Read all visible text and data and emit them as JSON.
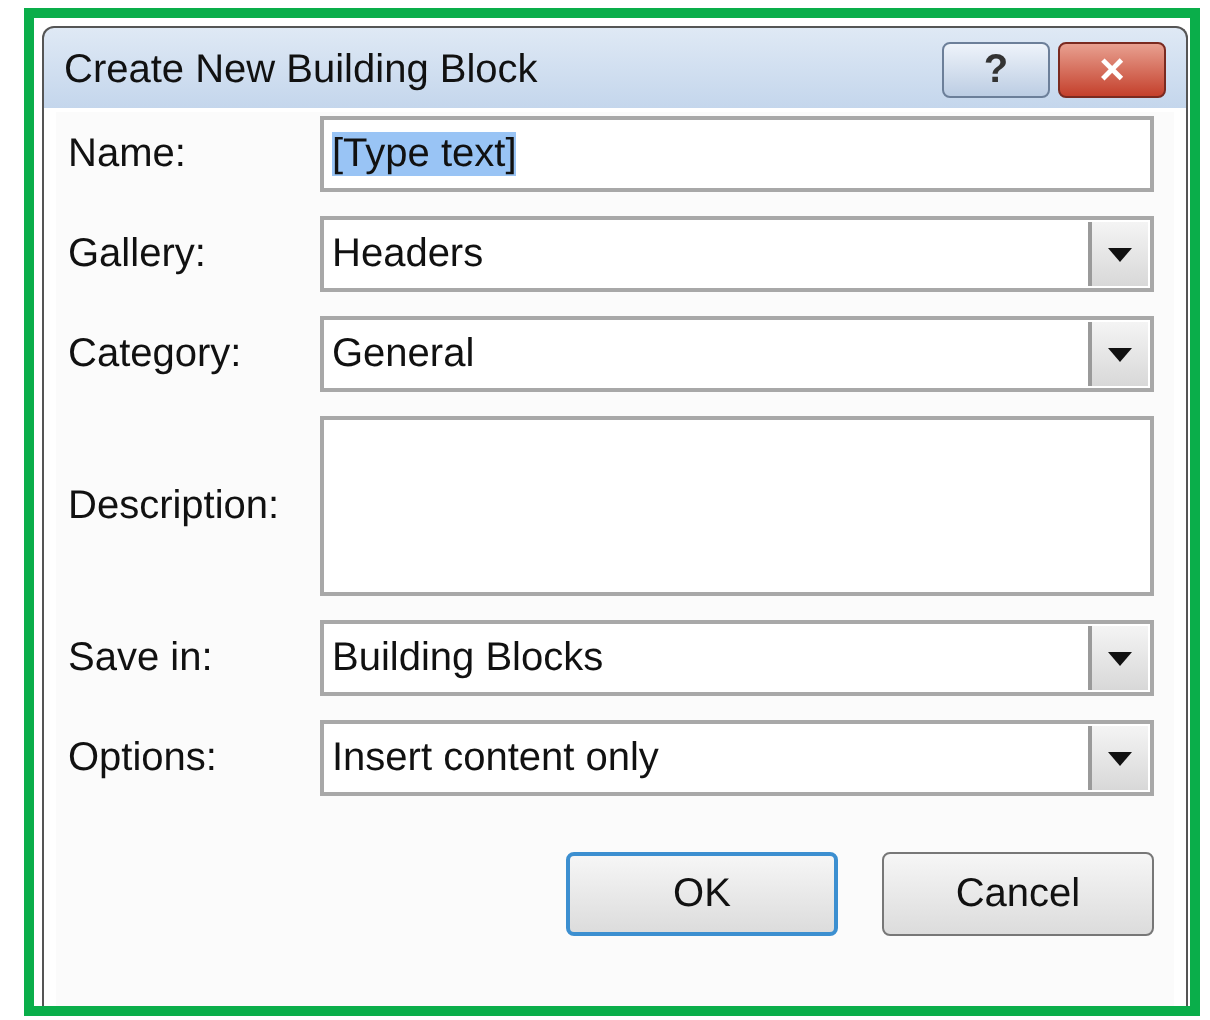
{
  "window": {
    "title": "Create New Building Block",
    "help_button": "?",
    "close_button": "×"
  },
  "fields": [
    {
      "label": "Name:",
      "kind": "text",
      "value": "[Type text]",
      "selected": true
    },
    {
      "label": "Gallery:",
      "kind": "dropdown",
      "value": "Headers"
    },
    {
      "label": "Category:",
      "kind": "dropdown",
      "value": "General"
    },
    {
      "label": "Description:",
      "kind": "textarea"
    },
    {
      "label": "Save in:",
      "kind": "dropdown",
      "value": "Building Blocks"
    },
    {
      "label": "Options:",
      "kind": "dropdown",
      "value": "Insert content only"
    }
  ],
  "buttons": [
    {
      "label": "OK",
      "default": true
    },
    {
      "label": "Cancel",
      "default": false
    }
  ]
}
